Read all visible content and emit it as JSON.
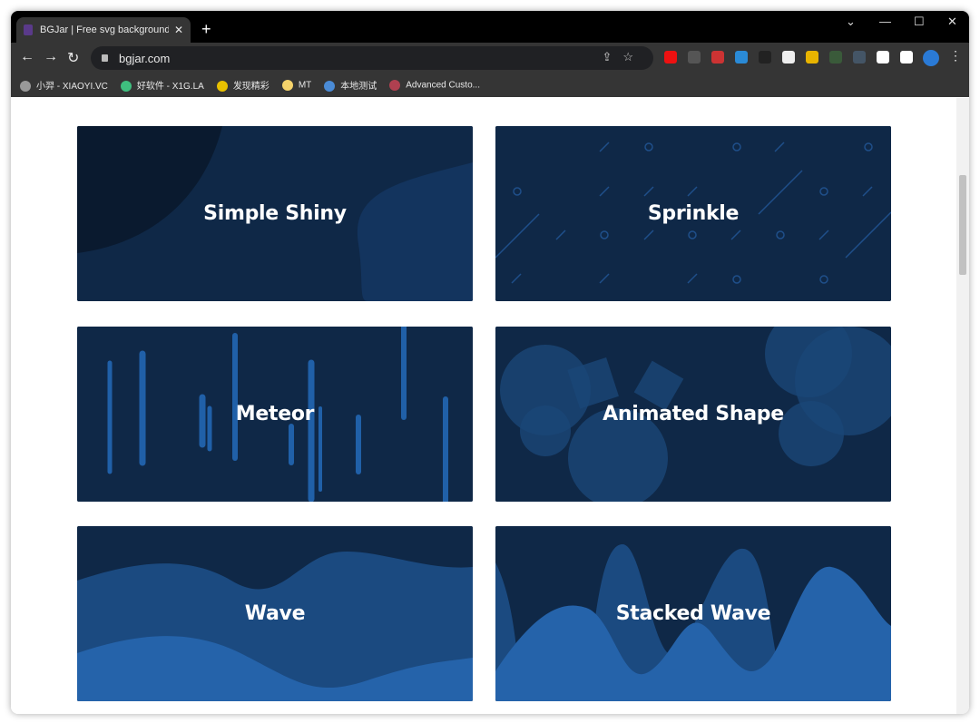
{
  "browser": {
    "tab_title": "BGJar | Free svg background i",
    "url": "bgjar.com",
    "bookmarks": [
      {
        "label": "小羿 - XIAOYI.VC",
        "color": "#999"
      },
      {
        "label": "好软件 - X1G.LA",
        "color": "#3fbf7f"
      },
      {
        "label": "发现精彩",
        "color": "#e8c000"
      },
      {
        "label": "MT",
        "color": "#f5d36b"
      },
      {
        "label": "本地测试",
        "color": "#4a8bd6"
      },
      {
        "label": "Advanced Custo...",
        "color": "#b04050"
      }
    ],
    "extension_colors": [
      "#e11",
      "#555",
      "#c33",
      "#2a8ad6",
      "#222",
      "#eee",
      "#e8b400",
      "#3a5a3a",
      "#456",
      "#fff",
      "#fff"
    ]
  },
  "cards": [
    {
      "label": "Simple Shiny"
    },
    {
      "label": "Sprinkle"
    },
    {
      "label": "Meteor"
    },
    {
      "label": "Animated Shape"
    },
    {
      "label": "Wave"
    },
    {
      "label": "Stacked Wave"
    }
  ]
}
